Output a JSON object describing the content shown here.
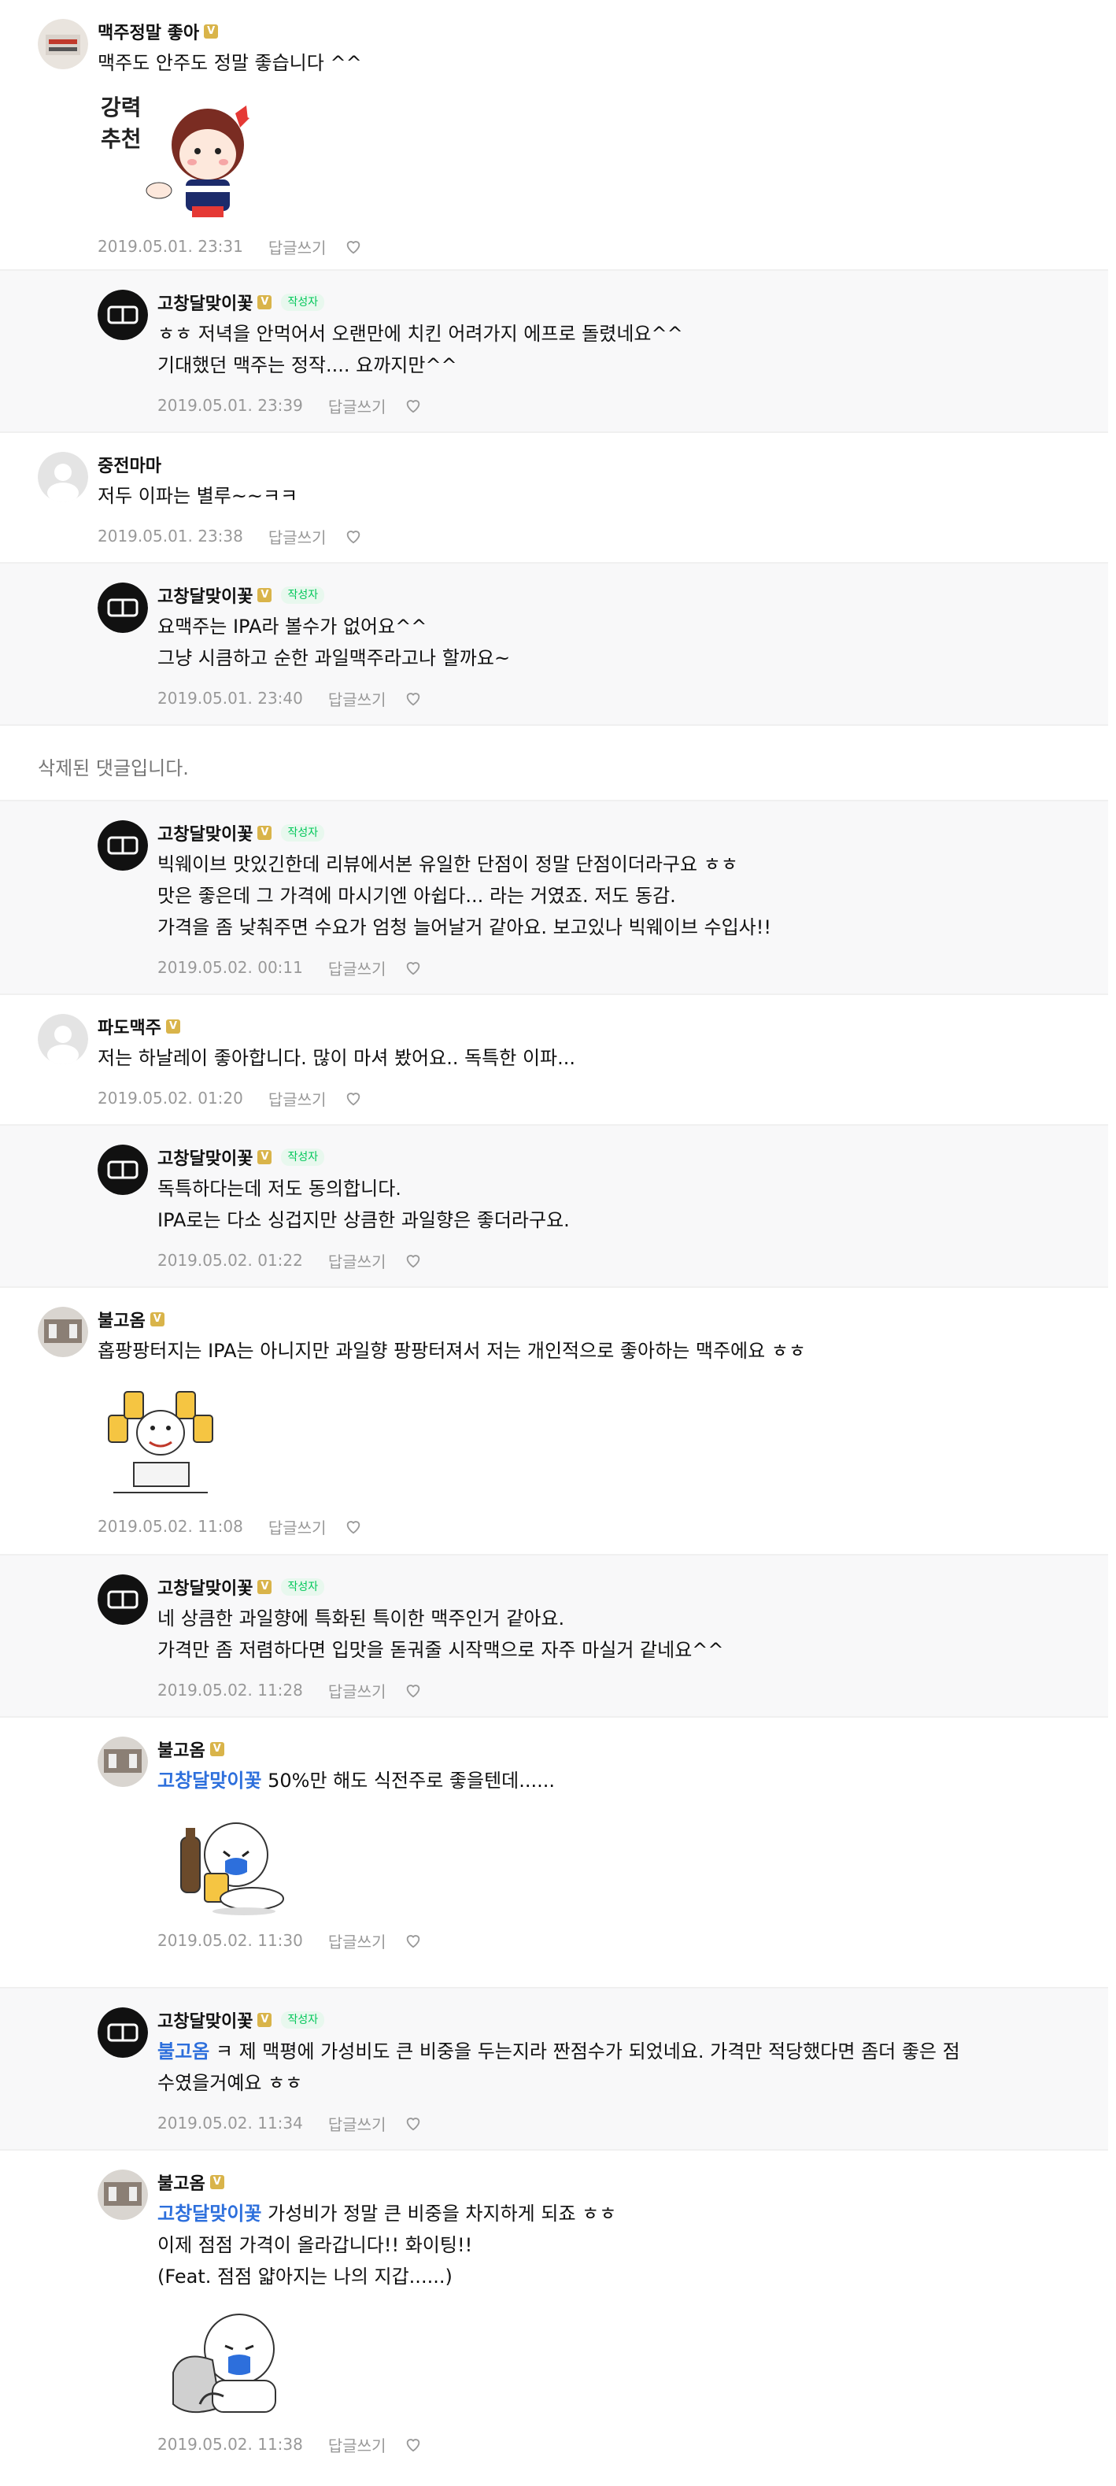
{
  "comments": [
    {
      "nick": "맥주정말 좋아",
      "badge": "V",
      "text": "맥주도 안주도 정말 좋습니다 ^^",
      "sticker": "powerful-recommend-sticker",
      "sticker_text": [
        "강력",
        "추천"
      ],
      "date": "2019.05.01. 23:31",
      "reply": "답글쓰기"
    },
    {
      "nick": "고창달맞이꽃",
      "badge": "V",
      "writer": "작성자",
      "text": "ㅎㅎ 저녁을 안먹어서 오랜만에 치킨 어려가지 에프로 돌렸네요^^\n기대했던 맥주는 정작.... 요까지만^^",
      "date": "2019.05.01. 23:39",
      "reply": "답글쓰기"
    },
    {
      "nick": "중전마마",
      "badge": "",
      "text": "저두 이파는 별루~~ㅋㅋ",
      "date": "2019.05.01. 23:38",
      "reply": "답글쓰기"
    },
    {
      "nick": "고창달맞이꽃",
      "badge": "V",
      "writer": "작성자",
      "text": "요맥주는 IPA라 볼수가 없어요^^\n그냥 시큼하고 순한 과일맥주라고나 할까요~",
      "date": "2019.05.01. 23:40",
      "reply": "답글쓰기"
    },
    {
      "deleted": "삭제된 댓글입니다."
    },
    {
      "nick": "고창달맞이꽃",
      "badge": "V",
      "writer": "작성자",
      "text": "빅웨이브 맛있긴한데 리뷰에서본 유일한 단점이 정말 단점이더라구요 ㅎㅎ\n맛은 좋은데 그 가격에 마시기엔 아쉽다... 라는 거였죠. 저도 동감.\n가격을 좀 낮춰주면 수요가 엄청 늘어날거 같아요. 보고있나 빅웨이브 수입사!!",
      "date": "2019.05.02. 00:11",
      "reply": "답글쓰기"
    },
    {
      "nick": "파도맥주",
      "badge": "V",
      "text": "저는 하날레이 좋아합니다. 많이 마셔 봤어요.. 독특한 이파...",
      "date": "2019.05.02. 01:20",
      "reply": "답글쓰기"
    },
    {
      "nick": "고창달맞이꽃",
      "badge": "V",
      "writer": "작성자",
      "text": "독특하다는데 저도 동의합니다.\nIPA로는 다소 싱겁지만 상큼한 과일향은 좋더라구요.",
      "date": "2019.05.02. 01:22",
      "reply": "답글쓰기"
    },
    {
      "nick": "불고옴",
      "badge": "V",
      "text": "홉팡팡터지는 IPA는 아니지만 과일향 팡팡터져서 저는 개인적으로 좋아하는 맥주에요 ㅎㅎ",
      "sticker": "beer-cheers-sticker",
      "date": "2019.05.02. 11:08",
      "reply": "답글쓰기"
    },
    {
      "nick": "고창달맞이꽃",
      "badge": "V",
      "writer": "작성자",
      "text": "네 상큼한 과일향에 특화된 특이한 맥주인거 같아요.\n가격만 좀 저렴하다면 입맛을 돋궈줄 시작맥으로 자주 마실거 같네요^^",
      "date": "2019.05.02. 11:28",
      "reply": "답글쓰기"
    },
    {
      "nick": "불고옴",
      "badge": "V",
      "mention": "고창달맞이꽃",
      "text": " 50%만 해도 식전주로 좋을텐데......",
      "sticker": "crying-drink-sticker",
      "date": "2019.05.02. 11:30",
      "reply": "답글쓰기"
    },
    {
      "nick": "고창달맞이꽃",
      "badge": "V",
      "writer": "작성자",
      "mention": "불고옴",
      "text": " ㅋ 제 맥평에 가성비도 큰 비중을 두는지라 짠점수가 되었네요. 가격만 적당했다면 좀더 좋은 점\n수였을거예요 ㅎㅎ",
      "date": "2019.05.02. 11:34",
      "reply": "답글쓰기"
    },
    {
      "nick": "불고옴",
      "badge": "V",
      "mention": "고창달맞이꽃",
      "text": " 가성비가 정말 큰 비중을 차지하게 되죠 ㅎㅎ\n이제 점점 가격이 올라갑니다!! 화이팅!!\n(Feat. 점점 얇아지는 나의 지갑......)",
      "sticker": "sad-sitting-sticker",
      "date": "2019.05.02. 11:38",
      "reply": "답글쓰기"
    }
  ]
}
